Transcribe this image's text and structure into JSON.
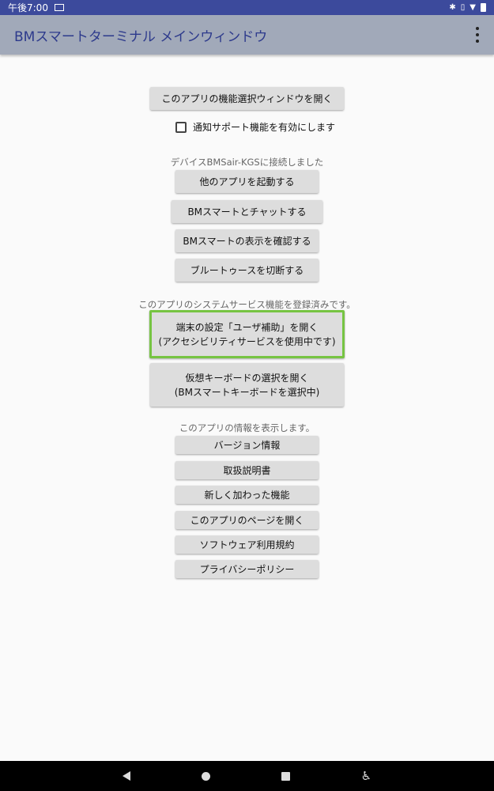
{
  "status_bar": {
    "time": "午後7:00",
    "icons": [
      "mail-icon",
      "bluetooth-icon",
      "vibrate-icon",
      "wifi-icon",
      "battery-icon"
    ]
  },
  "app_bar": {
    "title": "BMスマートターミナル メインウィンドウ",
    "menu_icon": "more-vert-icon"
  },
  "main": {
    "open_feature_window": "このアプリの機能選択ウィンドウを開く",
    "notify_support_label": "通知サポート機能を有効にします",
    "notify_support_checked": false,
    "device_status": "デバイスBMSair-KGSに接続しました",
    "device_buttons": [
      "他のアプリを起動する",
      "BMスマートとチャットする",
      "BMスマートの表示を確認する",
      "ブルートゥースを切断する"
    ],
    "service_status": "このアプリのシステムサービス機能を登録済みです。",
    "accessibility_line1": "端末の設定「ユーザ補助」を開く",
    "accessibility_line2": "(アクセシビリティサービスを使用中です)",
    "keyboard_line1": "仮想キーボードの選択を開く",
    "keyboard_line2": "(BMスマートキーボードを選択中)",
    "info_label": "このアプリの情報を表示します。",
    "info_buttons": [
      "バージョン情報",
      "取扱説明書",
      "新しく加わった機能",
      "このアプリのページを開く",
      "ソフトウェア利用規約",
      "プライバシーポリシー"
    ],
    "highlight_color": "#76c442"
  },
  "nav_bar": {
    "icons": [
      "back-icon",
      "home-icon",
      "recent-apps-icon",
      "accessibility-icon"
    ]
  }
}
